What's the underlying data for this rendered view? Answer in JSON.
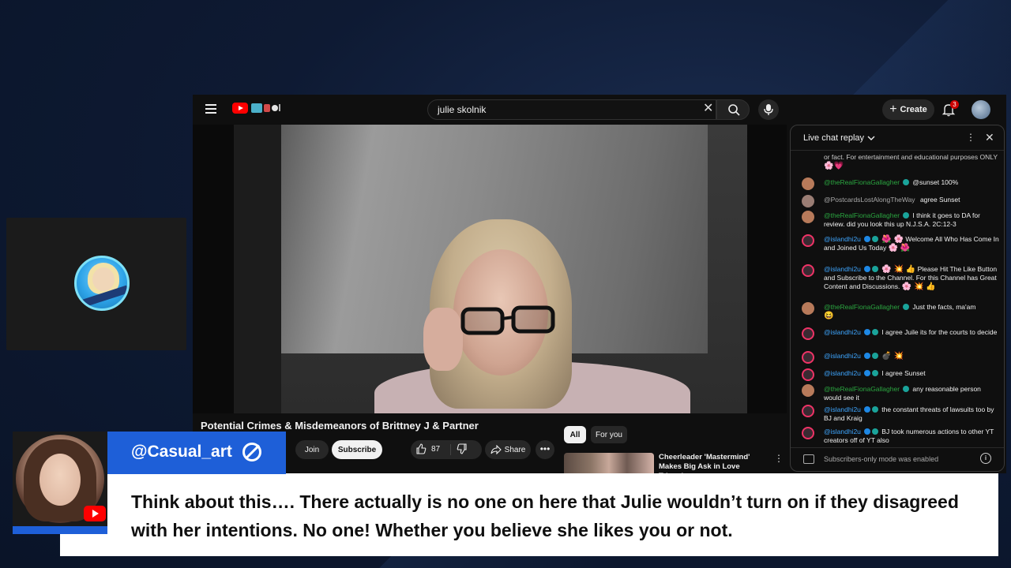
{
  "search": {
    "query": "julie skolnik"
  },
  "header": {
    "create_label": "Create",
    "notification_count": "3"
  },
  "video": {
    "title": "Potential Crimes & Misdemeanors of Brittney J & Partner",
    "join_label": "Join",
    "subscribe_label": "Subscribe",
    "like_count": "87",
    "share_label": "Share"
  },
  "chips": {
    "all": "All",
    "for_you": "For you"
  },
  "recommended": {
    "title": "Cheerleader 'Mastermind' Makes Big Ask in Love Triangl..."
  },
  "chat": {
    "header": "Live chat replay",
    "messages": [
      {
        "name": "",
        "text": "or fact. For entertainment and educational purposes ONLY"
      },
      {
        "name": "@theRealFionaGallagher",
        "text": "@sunset 100%"
      },
      {
        "name": "@PostcardsLostAlongTheWay",
        "text": "agree Sunset"
      },
      {
        "name": "@theRealFionaGallagher",
        "text": "I think it goes to DA for review. did you look this up N.J.S.A. 2C:12-3"
      },
      {
        "name": "@islandhi2u",
        "text": "Welcome All Who Has Come In and Joined Us Today"
      },
      {
        "name": "@islandhi2u",
        "text": "Please Hit The Like Button and Subscribe to the Channel. For this Channel has Great Content and Discussions."
      },
      {
        "name": "@theRealFionaGallagher",
        "text": "Just the facts, ma'am"
      },
      {
        "name": "@islandhi2u",
        "text": "I agree Juile its for the courts to decide"
      },
      {
        "name": "@islandhi2u",
        "text": ""
      },
      {
        "name": "@islandhi2u",
        "text": "I agree Sunset"
      },
      {
        "name": "@theRealFionaGallagher",
        "text": "any reasonable person would see it"
      },
      {
        "name": "@islandhi2u",
        "text": "the constant threats of lawsuits too by BJ and Kraig"
      },
      {
        "name": "@islandhi2u",
        "text": "BJ took numerous actions to other YT creators off of YT also"
      }
    ],
    "footer": "Subscribers-only mode was enabled"
  },
  "comment": {
    "author": "@Casual_art",
    "text": "Think about this…. There actually is no one on here that Julie wouldn’t turn on if they disagreed with her intentions. No one! Whether you believe she likes you or not."
  }
}
